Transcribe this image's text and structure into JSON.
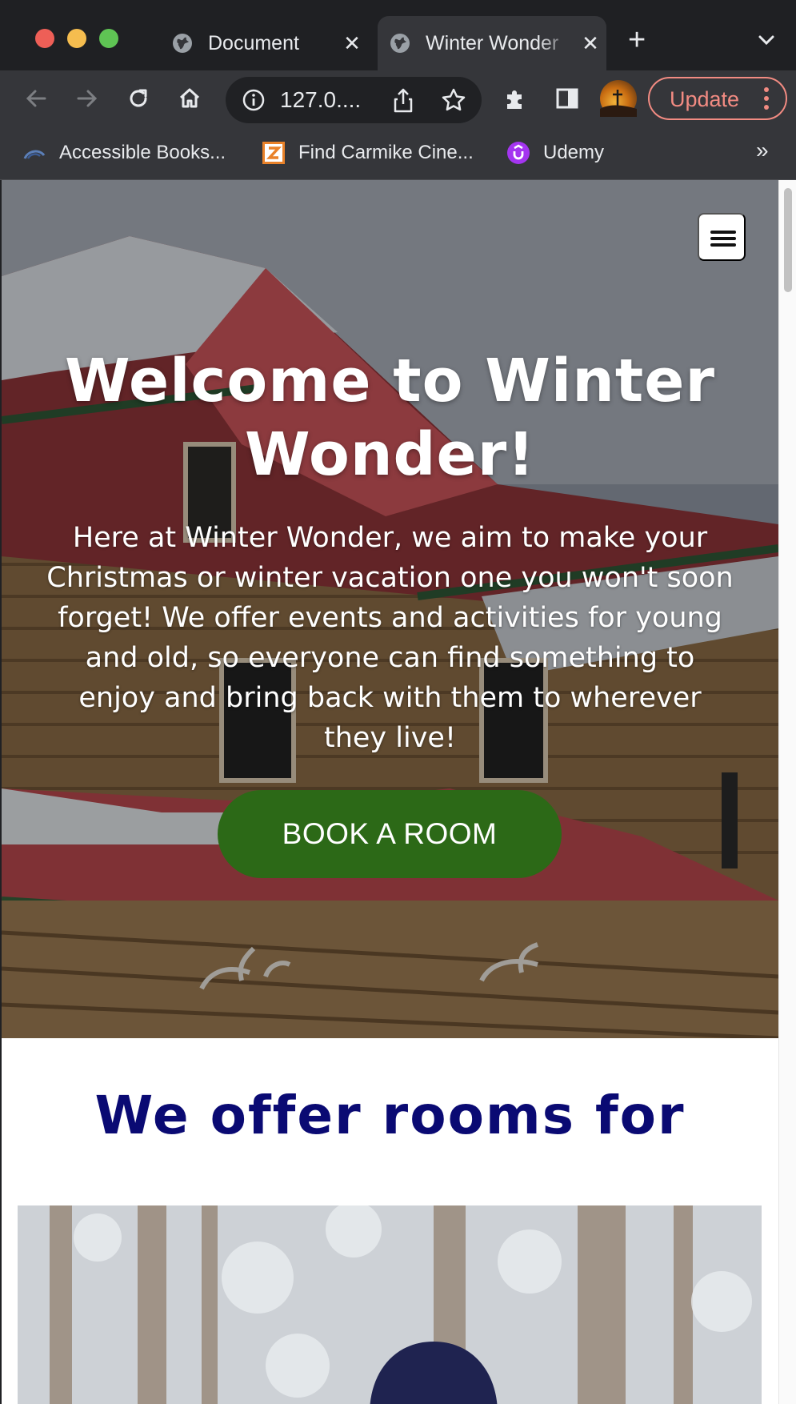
{
  "browser": {
    "tabs": [
      {
        "title": "Document",
        "active": false,
        "icon": "globe-icon"
      },
      {
        "title": "Winter Wonder",
        "active": true,
        "icon": "globe-icon"
      }
    ],
    "new_tab_label": "+",
    "url": "127.0....",
    "update_label": "Update",
    "bookmarks": [
      {
        "label": "Accessible Books...",
        "icon": "accessible-books-favicon"
      },
      {
        "label": "Find Carmike Cine...",
        "icon": "carmike-favicon"
      },
      {
        "label": "Udemy",
        "icon": "udemy-favicon"
      }
    ],
    "bookmarks_overflow": "»"
  },
  "hero": {
    "title": "Welcome to Winter Wonder!",
    "text": "Here at Winter Wonder, we aim to make your Christmas or winter vacation one you won't soon forget! We offer events and activities for young and old, so everyone can find something to enjoy and bring back with them to wherever they live!",
    "button_label": "BOOK A ROOM",
    "button_color": "#2c6917"
  },
  "offers": {
    "title": "We offer rooms for"
  },
  "colors": {
    "offers_title": "#0a0a73",
    "update_accent": "#f28b82"
  }
}
